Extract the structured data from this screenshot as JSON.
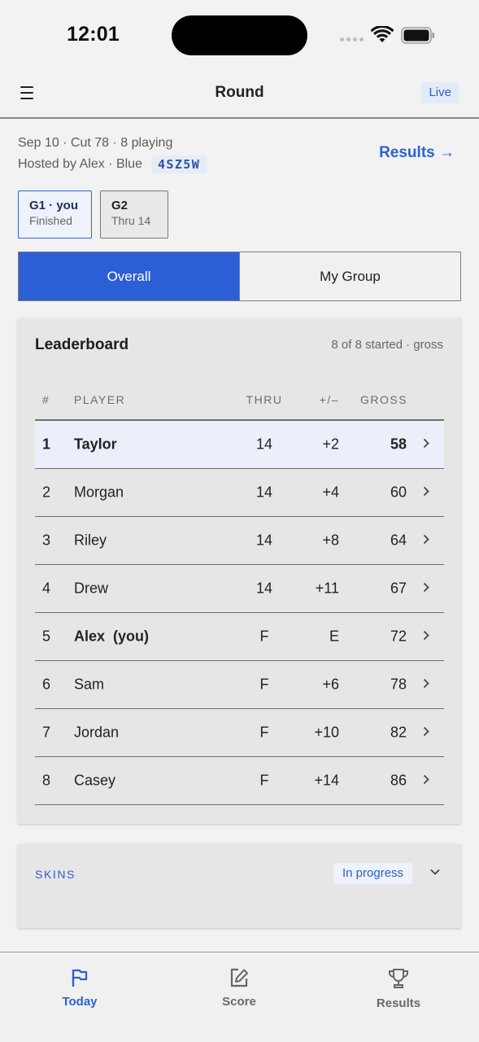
{
  "status_bar": {
    "time": "12:01"
  },
  "header": {
    "title": "Round",
    "live_badge": "Live"
  },
  "round": {
    "summary": "Sep 10 · Cut 78 · 8 playing",
    "host": "Hosted by Alex · Blue",
    "code": "4SZ5W",
    "results_link": "Results →"
  },
  "groups": [
    {
      "title": "G1 · you",
      "status": "Finished",
      "selected": true
    },
    {
      "title": "G2",
      "status": "Thru 14",
      "selected": false
    }
  ],
  "view_toggle": {
    "overall": "Overall",
    "my_group": "My Group",
    "selected": "overall"
  },
  "leaderboard": {
    "title": "Leaderboard",
    "meta": "8 of 8 started · gross",
    "columns": {
      "rank": "#",
      "player": "PLAYER",
      "thru": "THRU",
      "diff": "+/–",
      "gross": "GROSS"
    },
    "rows": [
      {
        "rank": "1",
        "player": "Taylor",
        "thru": "14",
        "diff": "+2",
        "gross": "58"
      },
      {
        "rank": "2",
        "player": "Morgan",
        "thru": "14",
        "diff": "+4",
        "gross": "60"
      },
      {
        "rank": "3",
        "player": "Riley",
        "thru": "14",
        "diff": "+8",
        "gross": "64"
      },
      {
        "rank": "4",
        "player": "Drew",
        "thru": "14",
        "diff": "+11",
        "gross": "67"
      },
      {
        "rank": "5",
        "player": "Alex  (you)",
        "thru": "F",
        "diff": "E",
        "gross": "72"
      },
      {
        "rank": "6",
        "player": "Sam",
        "thru": "F",
        "diff": "+6",
        "gross": "78"
      },
      {
        "rank": "7",
        "player": "Jordan",
        "thru": "F",
        "diff": "+10",
        "gross": "82"
      },
      {
        "rank": "8",
        "player": "Casey",
        "thru": "F",
        "diff": "+14",
        "gross": "86"
      }
    ]
  },
  "skins": {
    "label": "SKINS",
    "status": "In progress"
  },
  "bottom_nav": {
    "items": [
      {
        "label": "Today",
        "icon": "flag-icon",
        "active": true
      },
      {
        "label": "Score",
        "icon": "edit-icon",
        "active": false
      },
      {
        "label": "Results",
        "icon": "trophy-icon",
        "active": false
      }
    ]
  },
  "colors": {
    "accent": "#2c5fd6",
    "background": "#f2f2f2",
    "card": "#e6e6e6",
    "highlight_row": "#eaeff9"
  }
}
